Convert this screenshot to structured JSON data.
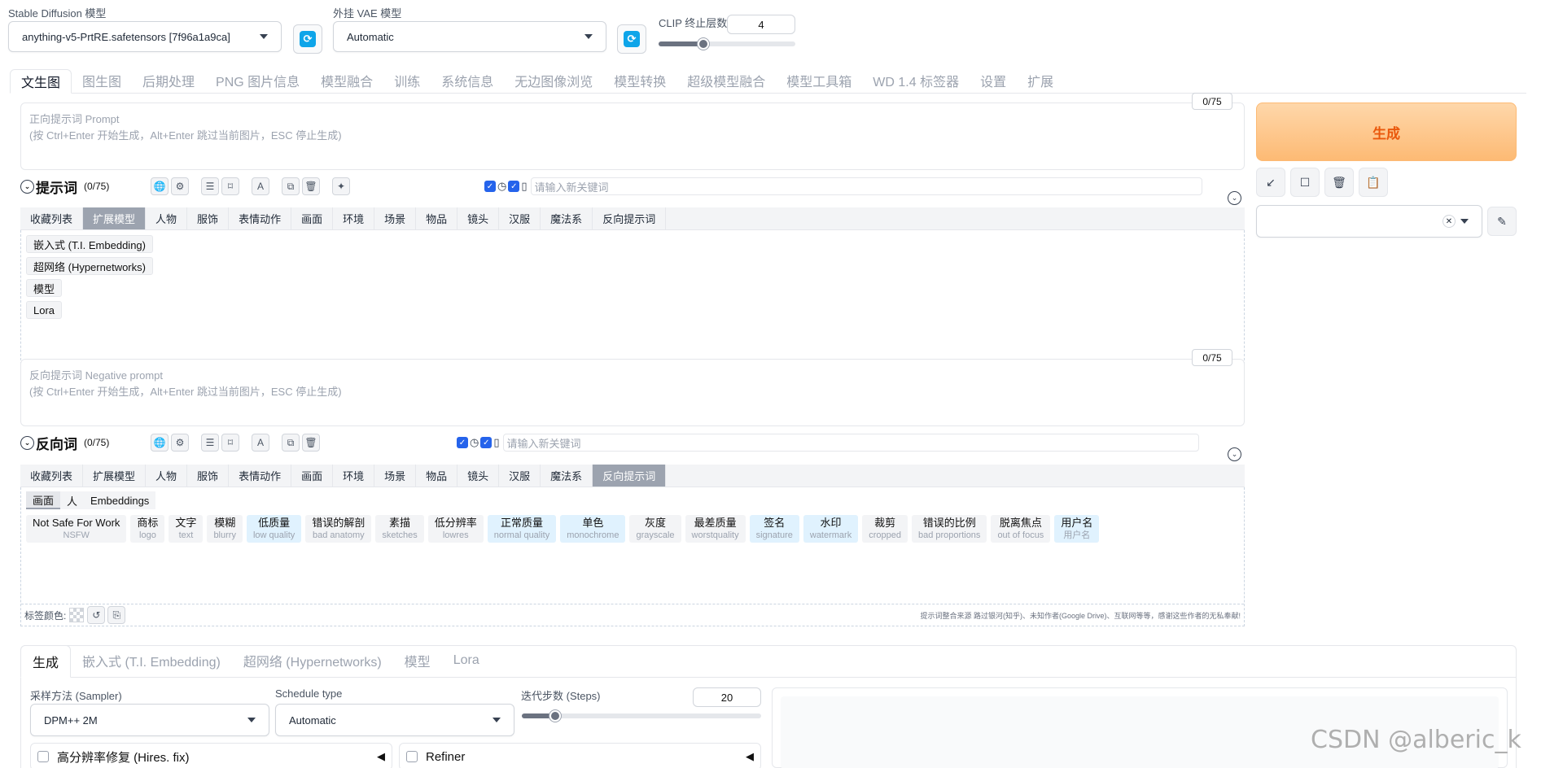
{
  "top": {
    "sd_model_label": "Stable Diffusion 模型",
    "sd_model_value": "anything-v5-PrtRE.safetensors [7f96a1a9ca]",
    "vae_label": "外挂 VAE 模型",
    "vae_value": "Automatic",
    "clip_label": "CLIP 终止层数",
    "clip_value": "4",
    "clip_fraction": 0.33
  },
  "main_tabs": [
    "文生图",
    "图生图",
    "后期处理",
    "PNG 图片信息",
    "模型融合",
    "训练",
    "系统信息",
    "无边图像浏览",
    "模型转换",
    "超级模型融合",
    "模型工具箱",
    "WD 1.4 标签器",
    "设置",
    "扩展"
  ],
  "prompt": {
    "placeholder_line1": "正向提示词 Prompt",
    "placeholder_line2": "(按 Ctrl+Enter 开始生成，Alt+Enter 跳过当前图片，ESC 停止生成)",
    "counter": "0/75",
    "section_title": "提示词",
    "section_count": "(0/75)",
    "keyword_placeholder": "请输入新关键词",
    "categories": [
      "收藏列表",
      "扩展模型",
      "人物",
      "服饰",
      "表情动作",
      "画面",
      "环境",
      "场景",
      "物品",
      "镜头",
      "汉服",
      "魔法系",
      "反向提示词"
    ],
    "active_category": "扩展模型",
    "sub_items": [
      "嵌入式 (T.I. Embedding)",
      "超网络 (Hypernetworks)",
      "模型",
      "Lora"
    ]
  },
  "negative": {
    "placeholder_line1": "反向提示词 Negative prompt",
    "placeholder_line2": "(按 Ctrl+Enter 开始生成，Alt+Enter 跳过当前图片，ESC 停止生成)",
    "counter": "0/75",
    "section_title": "反向词",
    "section_count": "(0/75)",
    "keyword_placeholder": "请输入新关键词",
    "categories": [
      "收藏列表",
      "扩展模型",
      "人物",
      "服饰",
      "表情动作",
      "画面",
      "环境",
      "场景",
      "物品",
      "镜头",
      "汉服",
      "魔法系",
      "反向提示词"
    ],
    "active_category": "反向提示词",
    "sub_tabs": [
      "画面",
      "人",
      "Embeddings"
    ],
    "tags": [
      {
        "zh": "Not Safe For Work",
        "en": "NSFW",
        "style": "gray"
      },
      {
        "zh": "商标",
        "en": "logo",
        "style": "gray"
      },
      {
        "zh": "文字",
        "en": "text",
        "style": "gray"
      },
      {
        "zh": "模糊",
        "en": "blurry",
        "style": "gray"
      },
      {
        "zh": "低质量",
        "en": "low quality",
        "style": "blue"
      },
      {
        "zh": "错误的解剖",
        "en": "bad anatomy",
        "style": "gray"
      },
      {
        "zh": "素描",
        "en": "sketches",
        "style": "gray"
      },
      {
        "zh": "低分辨率",
        "en": "lowres",
        "style": "gray"
      },
      {
        "zh": "正常质量",
        "en": "normal quality",
        "style": "blue"
      },
      {
        "zh": "单色",
        "en": "monochrome",
        "style": "blue"
      },
      {
        "zh": "灰度",
        "en": "grayscale",
        "style": "gray"
      },
      {
        "zh": "最差质量",
        "en": "worstquality",
        "style": "gray"
      },
      {
        "zh": "签名",
        "en": "signature",
        "style": "blue"
      },
      {
        "zh": "水印",
        "en": "watermark",
        "style": "blue"
      },
      {
        "zh": "裁剪",
        "en": "cropped",
        "style": "gray"
      },
      {
        "zh": "错误的比例",
        "en": "bad proportions",
        "style": "gray"
      },
      {
        "zh": "脱离焦点",
        "en": "out of focus",
        "style": "gray"
      },
      {
        "zh": "用户名",
        "en": "用户名",
        "style": "blue"
      }
    ],
    "tag_color_label": "标签颜色:",
    "credit_text": "提示词整合来源 路过银河(知乎)、未知作者(Google Drive)、互联网等等，感谢这些作者的无私奉献!"
  },
  "right": {
    "generate_label": "生成"
  },
  "bottom": {
    "tabs": [
      "生成",
      "嵌入式 (T.I. Embedding)",
      "超网络 (Hypernetworks)",
      "模型",
      "Lora"
    ],
    "sampler_label": "采样方法 (Sampler)",
    "sampler_value": "DPM++ 2M",
    "schedule_label": "Schedule type",
    "schedule_value": "Automatic",
    "steps_label": "迭代步数 (Steps)",
    "steps_value": "20",
    "steps_fraction": 0.14,
    "hires_label": "高分辨率修复 (Hires. fix)",
    "refiner_label": "Refiner"
  },
  "watermark": "CSDN @alberic_k"
}
